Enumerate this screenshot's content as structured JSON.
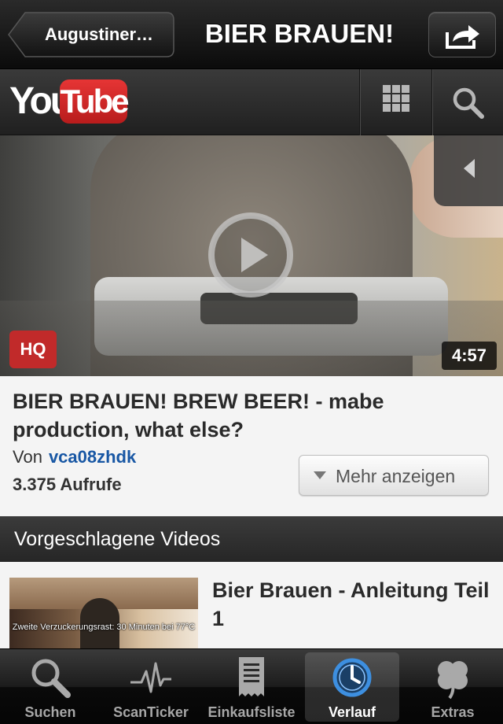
{
  "navbar": {
    "back_label": "Augustiner…",
    "title": "BIER BRAUEN!"
  },
  "youtube": {
    "logo_you": "You",
    "logo_tube": "Tube"
  },
  "video": {
    "hq_badge": "HQ",
    "duration": "4:57",
    "title": "BIER BRAUEN! BREW BEER! - mabe production, what else?",
    "by_prefix": "Von",
    "channel": "vca08zhdk",
    "views": "3.375 Aufrufe",
    "more_label": "Mehr anzeigen"
  },
  "suggestions": {
    "header": "Vorgeschlagene Videos",
    "items": [
      {
        "title": "Bier Brauen - Anleitung Teil 1",
        "thumb_caption": "Zweite Verzuckerungsrast: 30 Minuten bei 77°C"
      }
    ]
  },
  "tabbar": {
    "tabs": [
      {
        "label": "Suchen",
        "icon": "search-icon"
      },
      {
        "label": "ScanTicker",
        "icon": "pulse-icon"
      },
      {
        "label": "Einkaufsliste",
        "icon": "receipt-icon"
      },
      {
        "label": "Verlauf",
        "icon": "clock-icon"
      },
      {
        "label": "Extras",
        "icon": "clover-icon"
      }
    ],
    "active": "Verlauf"
  },
  "colors": {
    "accent_link": "#1857a4",
    "hq_red": "#c12a2a",
    "youtube_red": "#d32a2a",
    "active_tab_blue": "#3d8fe0"
  }
}
